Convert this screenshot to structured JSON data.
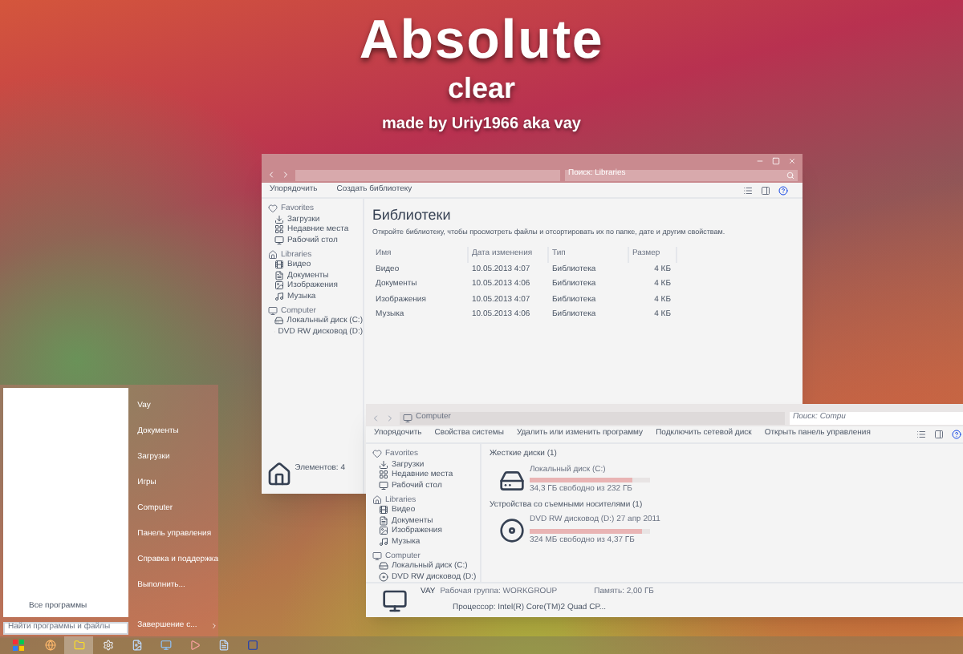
{
  "title": {
    "name": "Absolute",
    "subtitle": "clear",
    "credit": "made by Uriy1966 aka vay"
  },
  "library_window": {
    "search": {
      "placeholder": "Поиск: Libraries"
    },
    "toolbar": [
      "Упорядочить",
      "Создать библиотеку"
    ],
    "nav": [
      {
        "header": "Favorites",
        "items": [
          "Загрузки",
          "Недавние места",
          "Рабочий стол"
        ]
      },
      {
        "header": "Libraries",
        "items": [
          "Видео",
          "Документы",
          "Изображения",
          "Музыка"
        ]
      },
      {
        "header": "Computer",
        "items": [
          "Локальный диск (C:)",
          "DVD RW дисковод (D:)"
        ]
      }
    ],
    "heading": "Библиотеки",
    "description": "Откройте библиотеку, чтобы просмотреть файлы и отсортировать их по папке, дате и другим свойствам.",
    "table": {
      "columns": [
        "Имя",
        "Дата изменения",
        "Тип",
        "Размер"
      ],
      "rows": [
        [
          "Видео",
          "10.05.2013 4:07",
          "Библиотека",
          "4 КБ"
        ],
        [
          "Документы",
          "10.05.2013 4:06",
          "Библиотека",
          "4 КБ"
        ],
        [
          "Изображения",
          "10.05.2013 4:07",
          "Библиотека",
          "4 КБ"
        ],
        [
          "Музыка",
          "10.05.2013 4:06",
          "Библиотека",
          "4 КБ"
        ]
      ]
    },
    "status": "Элементов: 4"
  },
  "computer_window": {
    "address": "Computer",
    "search": {
      "placeholder": "Поиск: Compu"
    },
    "toolbar": [
      "Упорядочить",
      "Свойства системы",
      "Удалить или изменить программу",
      "Подключить сетевой диск",
      "Открыть панель управления"
    ],
    "nav": [
      {
        "header": "Favorites",
        "items": [
          "Загрузки",
          "Недавние места",
          "Рабочий стол"
        ]
      },
      {
        "header": "Libraries",
        "items": [
          "Видео",
          "Документы",
          "Изображения",
          "Музыка"
        ]
      },
      {
        "header": "Computer",
        "items": [
          "Локальный диск (C:)",
          "DVD RW дисковод (D:)"
        ]
      }
    ],
    "groups": [
      {
        "title": "Жесткие диски (1)",
        "drives": [
          {
            "kind": "hdd",
            "name": "Локальный диск (C:)",
            "level": 0.85,
            "free": "34,3 ГБ свободно из 232 ГБ"
          }
        ]
      },
      {
        "title": "Устройства со съемными носителями (1)",
        "drives": [
          {
            "kind": "dvd",
            "name": "DVD RW дисковод (D:) 27 апр 2011",
            "level": 0.93,
            "free": "324 МБ свободно из 4,37 ГБ"
          }
        ]
      }
    ],
    "details": {
      "computer": "VAY",
      "workgroup": "Рабочая группа: WORKGROUP",
      "memory": "Память: 2,00 ГБ",
      "cpu": "Процессор: Intel(R) Core(TM)2 Quad CP..."
    }
  },
  "start_menu": {
    "all_programs": "Все программы",
    "search": {
      "placeholder": "Найти программы и файлы"
    },
    "links": [
      "Vay",
      "Документы",
      "Загрузки",
      "Игры",
      "Computer",
      "Панель управления",
      "Справка и поддержка",
      "Выполнить..."
    ],
    "shutdown": "Завершение с..."
  },
  "taskbar": {
    "items": [
      {
        "selected": false
      },
      {
        "selected": true
      },
      {
        "selected": false
      },
      {
        "selected": false
      },
      {
        "selected": false
      },
      {
        "selected": false
      },
      {
        "selected": false
      },
      {
        "selected": false
      }
    ]
  }
}
